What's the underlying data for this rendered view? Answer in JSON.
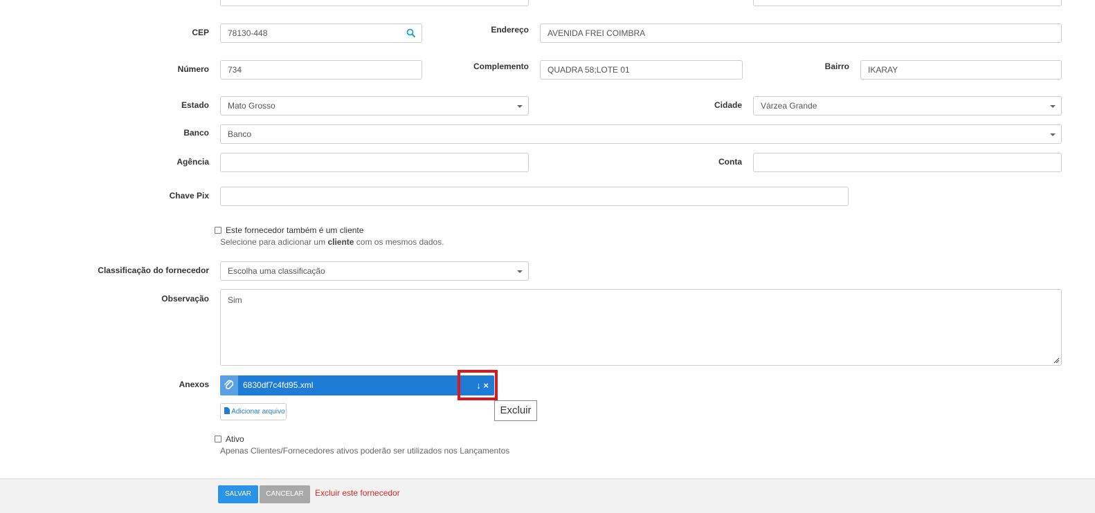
{
  "form": {
    "cep": {
      "label": "CEP",
      "value": "78130-448"
    },
    "endereco": {
      "label": "Endereço",
      "value": "AVENIDA FREI COIMBRA"
    },
    "numero": {
      "label": "Número",
      "value": "734"
    },
    "complemento": {
      "label": "Complemento",
      "value": "QUADRA 58;LOTE 01"
    },
    "bairro": {
      "label": "Bairro",
      "value": "IKARAY"
    },
    "estado": {
      "label": "Estado",
      "value": "Mato Grosso"
    },
    "cidade": {
      "label": "Cidade",
      "value": "Várzea Grande"
    },
    "banco": {
      "label": "Banco",
      "value": "Banco"
    },
    "agencia": {
      "label": "Agência",
      "value": ""
    },
    "conta": {
      "label": "Conta",
      "value": ""
    },
    "chave_pix": {
      "label": "Chave Pix",
      "value": ""
    },
    "cliente_checkbox": {
      "label": "Este fornecedor também é um cliente",
      "help_prefix": "Selecione para adicionar um ",
      "help_bold": "cliente",
      "help_suffix": " com os mesmos dados."
    },
    "classificacao": {
      "label": "Classificação do fornecedor",
      "value": "Escolha uma classificação"
    },
    "observacao": {
      "label": "Observação",
      "value": "Sim"
    },
    "anexos": {
      "label": "Anexos",
      "file_name": "6830df7c4fd95.xml",
      "download_glyph": "↓",
      "delete_glyph": "×",
      "tooltip": "Excluir",
      "add_button": "Adicionar arquivo"
    },
    "ativo": {
      "label": "Ativo",
      "help": "Apenas Clientes/Fornecedores ativos poderão ser utilizados nos Lançamentos"
    }
  },
  "footer": {
    "save": "SALVAR",
    "cancel": "CANCELAR",
    "delete_link": "Excluir este fornecedor"
  },
  "colors": {
    "primary": "#1e7bd6",
    "save": "#2b93e6",
    "cancel": "#a8a8a8",
    "danger": "#d8262a",
    "highlight": "#e0141c"
  }
}
